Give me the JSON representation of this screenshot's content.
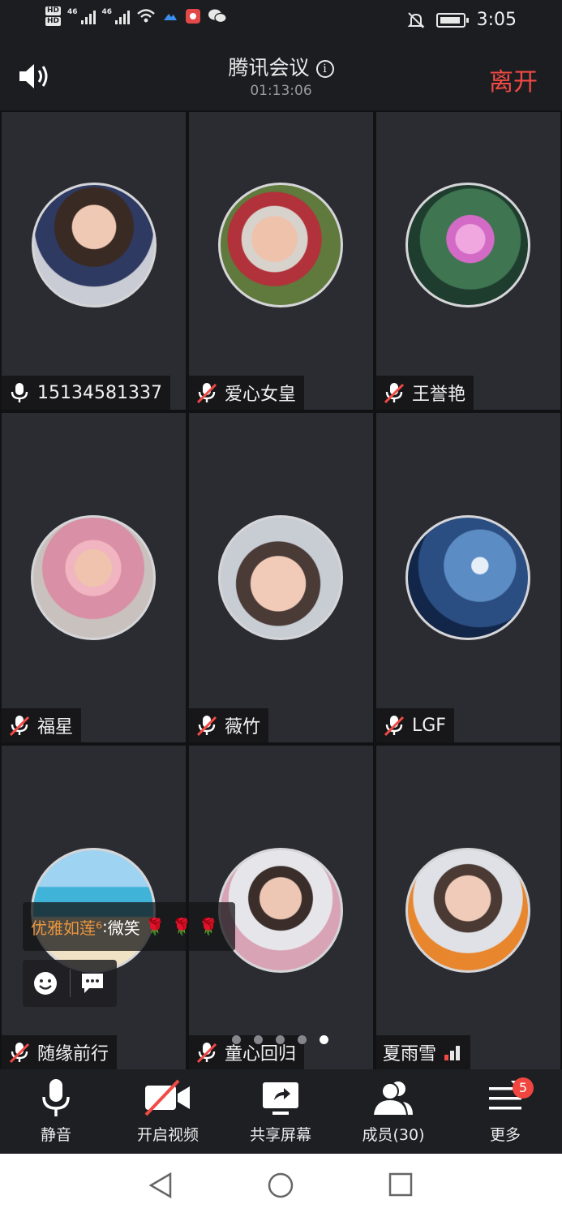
{
  "status": {
    "time": "3:05",
    "hd1": "HD",
    "hd2": "HD",
    "net1": "46",
    "net2": "46"
  },
  "header": {
    "title": "腾讯会议",
    "timer": "01:13:06",
    "leave": "离开"
  },
  "participants": [
    {
      "name": "15134581337",
      "muted": false,
      "avatar": "woman-scarf"
    },
    {
      "name": "爱心女皇",
      "muted": true,
      "avatar": "elderly-woman"
    },
    {
      "name": "王誉艳",
      "muted": true,
      "avatar": "lotus-flower"
    },
    {
      "name": "福星",
      "muted": true,
      "avatar": "woman-headband"
    },
    {
      "name": "薇竹",
      "muted": true,
      "avatar": "woman-glasses"
    },
    {
      "name": "LGF",
      "muted": true,
      "avatar": "earth-globe"
    },
    {
      "name": "随缘前行",
      "muted": true,
      "avatar": "sea-beach"
    },
    {
      "name": "童心回归",
      "muted": true,
      "avatar": "woman-coat"
    },
    {
      "name": "夏雨雪",
      "muted": false,
      "avatar": "woman-smiling"
    }
  ],
  "chat": {
    "sender": "优雅如莲⁶",
    "sep": ": ",
    "message": "微笑",
    "roses": "🌹🌹🌹"
  },
  "pager": {
    "pages": 5,
    "current": 5
  },
  "toolbar": {
    "mute": "静音",
    "video": "开启视频",
    "share": "共享屏幕",
    "members": "成员(30)",
    "more": "更多",
    "more_badge": "5"
  },
  "colors": {
    "accent": "#f24a44",
    "tile": "#2a2c31",
    "chat_name": "#e9963f"
  }
}
